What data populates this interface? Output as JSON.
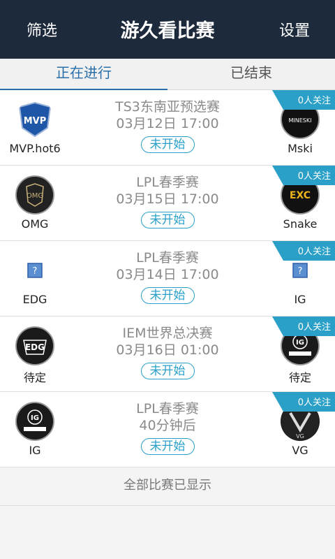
{
  "header": {
    "filter_label": "筛选",
    "title": "游久看比赛",
    "settings_label": "设置"
  },
  "tabs": {
    "active": "正在进行",
    "inactive": "已结束"
  },
  "matches": [
    {
      "left": {
        "name": "MVP.hot6"
      },
      "right": {
        "name": "Mski"
      },
      "league": "TS3东南亚预选赛",
      "time": "03月12日 17:00",
      "status": "未开始",
      "followers": "0人关注"
    },
    {
      "left": {
        "name": "OMG"
      },
      "right": {
        "name": "Snake"
      },
      "league": "LPL春季赛",
      "time": "03月15日 17:00",
      "status": "未开始",
      "followers": "0人关注"
    },
    {
      "left": {
        "name": "EDG"
      },
      "right": {
        "name": "IG"
      },
      "league": "LPL春季赛",
      "time": "03月14日 17:00",
      "status": "未开始",
      "followers": "0人关注"
    },
    {
      "left": {
        "name": "待定"
      },
      "right": {
        "name": "待定"
      },
      "league": "IEM世界总决赛",
      "time": "03月16日 01:00",
      "status": "未开始",
      "followers": "0人关注"
    },
    {
      "left": {
        "name": "IG"
      },
      "right": {
        "name": "VG"
      },
      "league": "LPL春季赛",
      "time": "40分钟后",
      "status": "未开始",
      "followers": "0人关注"
    }
  ],
  "footer": "全部比赛已显示",
  "colors": {
    "header_bg": "#1c2a3b",
    "accent": "#2aa0c8",
    "tab_active": "#2a6fa8"
  },
  "logo_text": {
    "mvp": "MVP",
    "mski": "MINESKI",
    "omg": "OMG",
    "exc": "EXC",
    "edg": "EDG",
    "ig": "IG",
    "vg": "VG"
  }
}
